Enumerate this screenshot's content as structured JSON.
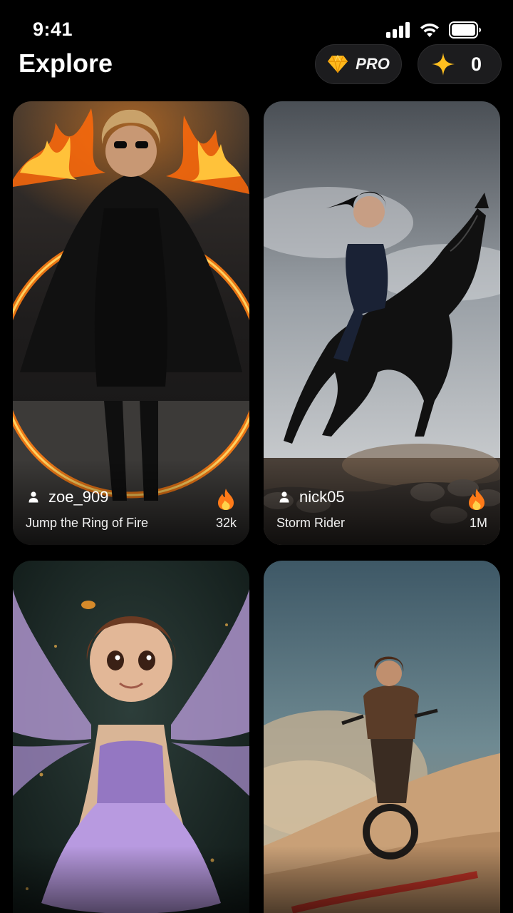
{
  "status": {
    "time": "9:41"
  },
  "header": {
    "title": "Explore",
    "pro_label": "PRO",
    "credits": "0"
  },
  "icons": {
    "pro": "diamond-icon",
    "credits": "sparkle-icon",
    "user": "person-icon",
    "likes": "fire-icon"
  },
  "colors": {
    "background": "#000000",
    "pill": "#1c1c1e",
    "diamond": "#ffb81c",
    "sparkle": "#ffbf1f",
    "fire": "#ff7a18"
  },
  "cards": [
    {
      "username": "zoe_909",
      "title": "Jump the Ring of Fire",
      "count": "32k"
    },
    {
      "username": "nick05",
      "title": "Storm Rider",
      "count": "1M"
    },
    {
      "username": "",
      "title": "",
      "count": ""
    },
    {
      "username": "",
      "title": "",
      "count": ""
    }
  ]
}
